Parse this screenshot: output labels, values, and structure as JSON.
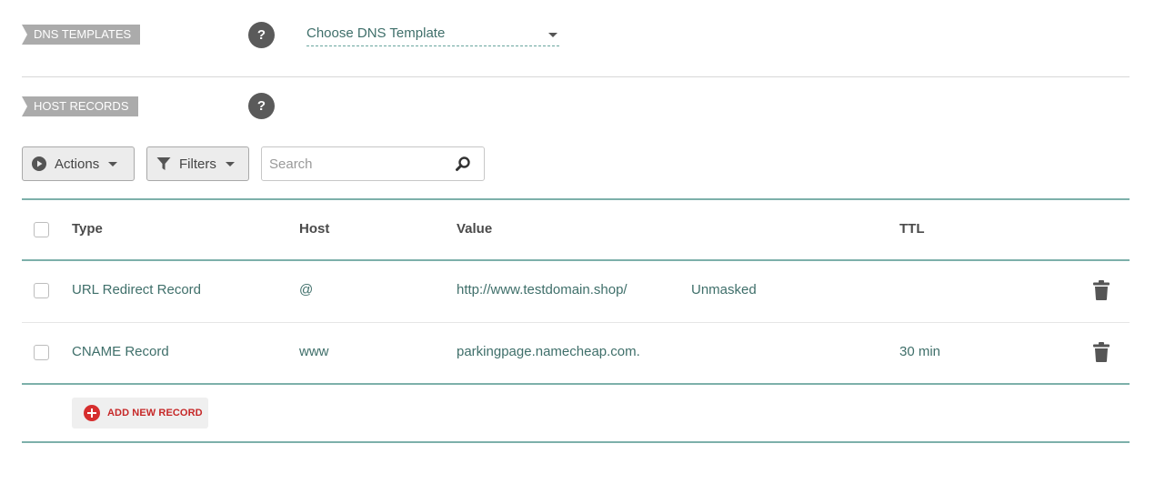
{
  "dns_templates": {
    "label": "DNS TEMPLATES",
    "help": "?",
    "select_value": "Choose DNS Template"
  },
  "host_records": {
    "label": "HOST RECORDS",
    "help": "?"
  },
  "toolbar": {
    "actions_label": "Actions",
    "filters_label": "Filters",
    "search_placeholder": "Search"
  },
  "table": {
    "columns": [
      "Type",
      "Host",
      "Value",
      "TTL"
    ],
    "rows": [
      {
        "type": "URL Redirect Record",
        "host": "@",
        "value": "http://www.testdomain.shop/",
        "extra": "Unmasked",
        "ttl": ""
      },
      {
        "type": "CNAME Record",
        "host": "www",
        "value": "parkingpage.namecheap.com.",
        "extra": "",
        "ttl": "30 min"
      }
    ]
  },
  "add_record_label": "ADD NEW RECORD",
  "colors": {
    "teal_text": "#3f6f6a",
    "teal_line": "#7db0aa",
    "label_bg": "#ababab",
    "add_red": "#d62e2e"
  }
}
